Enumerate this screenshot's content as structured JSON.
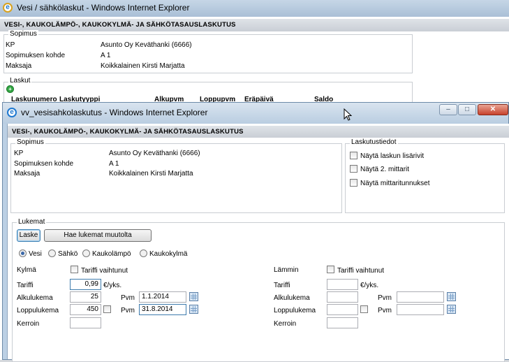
{
  "bg_window": {
    "title": "Vesi / sähkölaskut - Windows Internet Explorer",
    "header": "VESI-, KAUKOLÄMPÖ-, KAUKOKYLMÄ- JA SÄHKÖTASAUSLASKUTUS",
    "sopimus_legend": "Sopimus",
    "rows": [
      {
        "label": "KP",
        "value": "Asunto Oy Keväthanki (6666)"
      },
      {
        "label": "Sopimuksen kohde",
        "value": "A 1"
      },
      {
        "label": "Maksaja",
        "value": "Koikkalainen Kirsti Marjatta"
      }
    ],
    "laskut_legend": "Laskut",
    "laskut_columns": [
      "Laskunumero",
      "Laskutyyppi",
      "Alkupvm",
      "Loppupvm",
      "Eräpäivä",
      "Saldo"
    ]
  },
  "fg_window": {
    "title": "vv_vesisahkolaskutus - Windows Internet Explorer",
    "header": "VESI-, KAUKOLÄMPÖ-, KAUKOKYLMÄ- JA SÄHKÖTASAUSLASKUTUS",
    "sopimus_legend": "Sopimus",
    "rows": [
      {
        "label": "KP",
        "value": "Asunto Oy Keväthanki (6666)"
      },
      {
        "label": "Sopimuksen kohde",
        "value": "A 1"
      },
      {
        "label": "Maksaja",
        "value": "Koikkalainen Kirsti Marjatta"
      }
    ],
    "laskutustiedot": {
      "legend": "Laskutustiedot",
      "options": [
        "Näytä laskun lisärivit",
        "Näytä 2. mittarit",
        "Näytä mittaritunnukset"
      ]
    },
    "lukemat": {
      "legend": "Lukemat",
      "laske_label": "Laske",
      "hae_label": "Hae lukemat muutolta",
      "radios": [
        "Vesi",
        "Sähkö",
        "Kaukolämpö",
        "Kaukokylmä"
      ],
      "selected_radio": "Vesi",
      "left": {
        "title": "Kylmä",
        "tariffi_vaihtunut": "Tariffi vaihtunut",
        "tariffi_label": "Tariffi",
        "tariffi_value": "0,99",
        "unit": "€/yks.",
        "alkulukema_label": "Alkulukema",
        "alkulukema_value": "25",
        "pvm_label": "Pvm",
        "alku_pvm": "1.1.2014",
        "loppulukema_label": "Loppulukema",
        "loppulukema_value": "450",
        "loppu_pvm": "31.8.2014",
        "kerroin_label": "Kerroin",
        "kerroin_value": ""
      },
      "right": {
        "title": "Lämmin",
        "tariffi_vaihtunut": "Tariffi vaihtunut",
        "tariffi_label": "Tariffi",
        "tariffi_value": "",
        "unit": "€/yks.",
        "alkulukema_label": "Alkulukema",
        "alkulukema_value": "",
        "pvm_label": "Pvm",
        "alku_pvm": "",
        "loppulukema_label": "Loppulukema",
        "loppulukema_value": "",
        "loppu_pvm": "",
        "kerroin_label": "Kerroin",
        "kerroin_value": ""
      }
    }
  }
}
